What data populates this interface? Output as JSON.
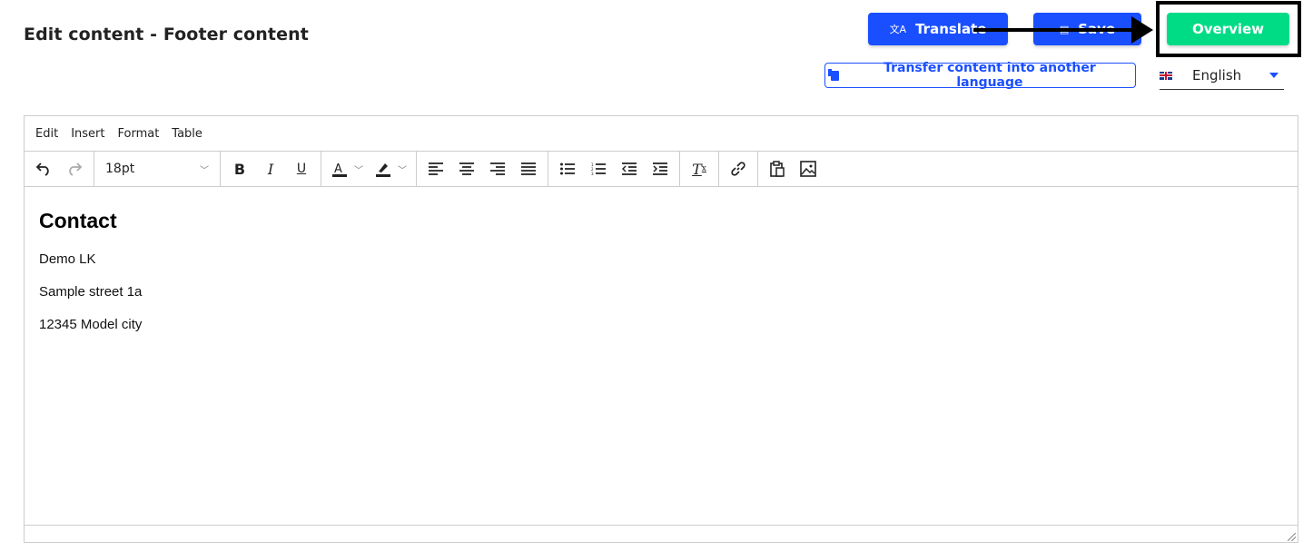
{
  "header": {
    "title": "Edit content - Footer content",
    "translate_label": "Translate",
    "save_label": "Save",
    "overview_label": "Overview",
    "transfer_label": "Transfer content into another language",
    "language": {
      "selected": "English",
      "flag": "uk-flag"
    }
  },
  "editor": {
    "menu": [
      "Edit",
      "Insert",
      "Format",
      "Table"
    ],
    "font_size": "18pt",
    "content": {
      "heading": "Contact",
      "lines": [
        "Demo LK",
        "Sample street 1a",
        "12345 Model city"
      ]
    }
  },
  "annotation": {
    "color": "#000000",
    "target": "overview-button"
  },
  "colors": {
    "primary": "#1a4fff",
    "success": "#00dc86"
  }
}
